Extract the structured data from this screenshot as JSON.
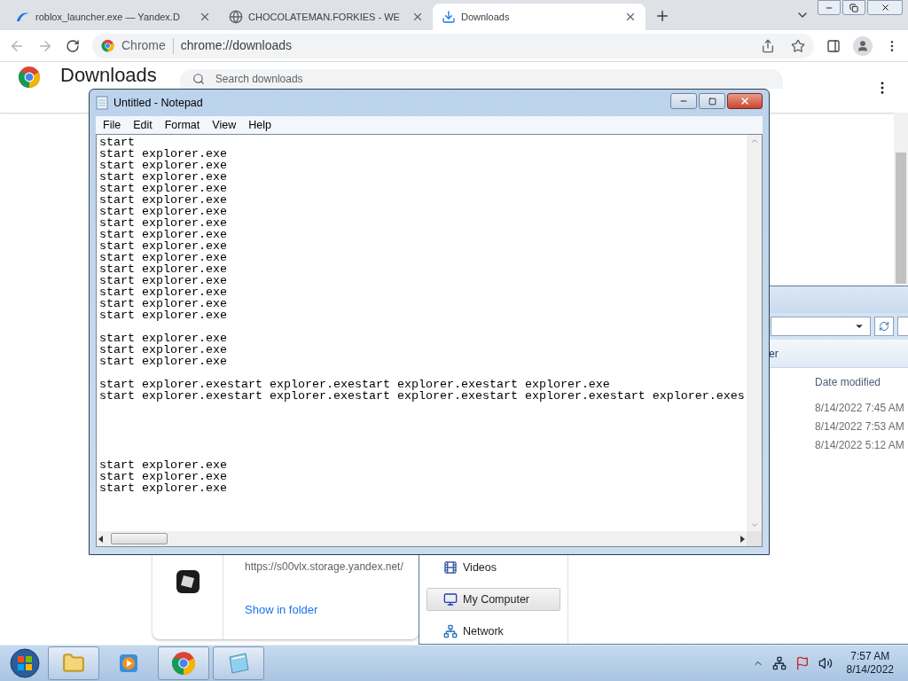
{
  "browser": {
    "tabs": [
      {
        "title": "roblox_launcher.exe — Yandex.D",
        "kind": "yandex",
        "selected": false
      },
      {
        "title": "CHOCOLATEMAN.FORKIES - WE",
        "kind": "globe",
        "selected": false
      },
      {
        "title": "Downloads",
        "kind": "download",
        "selected": true
      }
    ],
    "address": {
      "site_label": "Chrome",
      "url": "chrome://downloads"
    }
  },
  "downloads_page": {
    "title": "Downloads",
    "search_placeholder": "Search downloads",
    "items": [
      {
        "url": "https://s00vlx.storage.yandex.net/",
        "action": "Show in folder"
      }
    ]
  },
  "explorer": {
    "toolbar_label": "er",
    "column": "Date modified",
    "rows": [
      "8/14/2022 7:45 AM",
      "8/14/2022 7:53 AM",
      "8/14/2022 5:12 AM"
    ],
    "nav_items": [
      {
        "label": "Videos",
        "kind": "videos",
        "selected": false
      },
      {
        "label": "My Computer",
        "kind": "computer",
        "selected": true
      },
      {
        "label": "Network",
        "kind": "network",
        "selected": false
      }
    ]
  },
  "notepad": {
    "title": "Untitled - Notepad",
    "menu": [
      "File",
      "Edit",
      "Format",
      "View",
      "Help"
    ],
    "text": "start\nstart explorer.exe\nstart explorer.exe\nstart explorer.exe\nstart explorer.exe\nstart explorer.exe\nstart explorer.exe\nstart explorer.exe\nstart explorer.exe\nstart explorer.exe\nstart explorer.exe\nstart explorer.exe\nstart explorer.exe\nstart explorer.exe\nstart explorer.exe\nstart explorer.exe\n\nstart explorer.exe\nstart explorer.exe\nstart explorer.exe\n\nstart explorer.exestart explorer.exestart explorer.exestart explorer.exe\nstart explorer.exestart explorer.exestart explorer.exestart explorer.exestart explorer.exes\n\n\n\n\n\nstart explorer.exe\nstart explorer.exe\nstart explorer.exe"
  },
  "taskbar": {
    "apps": [
      {
        "kind": "explorer",
        "running": true
      },
      {
        "kind": "media",
        "running": false
      },
      {
        "kind": "chrome",
        "running": true
      },
      {
        "kind": "notepad",
        "running": true
      }
    ],
    "time": "7:57 AM",
    "date": "8/14/2022"
  }
}
